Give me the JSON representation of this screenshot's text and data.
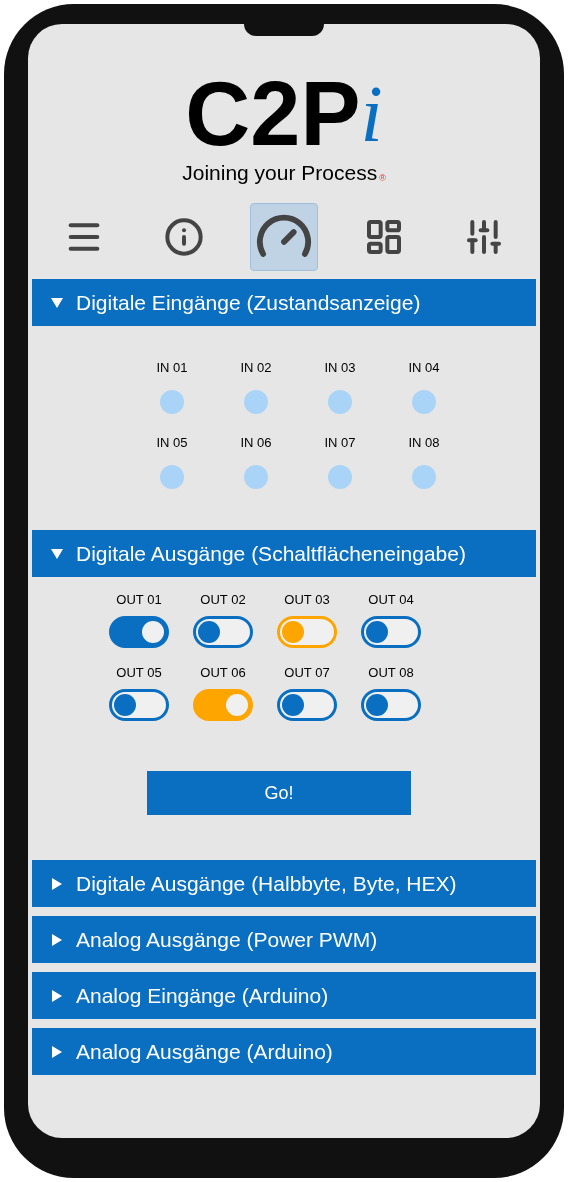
{
  "logo": {
    "main": "C2P",
    "accent": "i",
    "tagline": "Joining your Process",
    "mark": "®"
  },
  "nav": [
    {
      "kind": "menu",
      "selected": false
    },
    {
      "kind": "info",
      "selected": false
    },
    {
      "kind": "gauge",
      "selected": true
    },
    {
      "kind": "dashboard",
      "selected": false
    },
    {
      "kind": "sliders",
      "selected": false
    }
  ],
  "sections": [
    {
      "title": "Digitale Eingänge (Zustandsanzeige)",
      "expanded": true,
      "kind": "inputs",
      "items": [
        {
          "label": "IN 01",
          "on": false
        },
        {
          "label": "IN 02",
          "on": false
        },
        {
          "label": "IN 03",
          "on": false
        },
        {
          "label": "IN 04",
          "on": false
        },
        {
          "label": "IN 05",
          "on": false
        },
        {
          "label": "IN 06",
          "on": false
        },
        {
          "label": "IN 07",
          "on": false
        },
        {
          "label": "IN 08",
          "on": false
        }
      ]
    },
    {
      "title": "Digitale Ausgänge (Schaltflächeneingabe)",
      "expanded": true,
      "kind": "outputs",
      "button": "Go!",
      "items": [
        {
          "label": "OUT 01",
          "on": true,
          "color": "#0b6fc1"
        },
        {
          "label": "OUT 02",
          "on": false,
          "color": "#0b6fc1"
        },
        {
          "label": "OUT 03",
          "on": false,
          "color": "#ffa500"
        },
        {
          "label": "OUT 04",
          "on": false,
          "color": "#0b6fc1"
        },
        {
          "label": "OUT 05",
          "on": false,
          "color": "#0b6fc1"
        },
        {
          "label": "OUT 06",
          "on": true,
          "color": "#ffa500"
        },
        {
          "label": "OUT 07",
          "on": false,
          "color": "#0b6fc1"
        },
        {
          "label": "OUT 08",
          "on": false,
          "color": "#0b6fc1"
        }
      ]
    },
    {
      "title": "Digitale Ausgänge (Halbbyte, Byte, HEX)",
      "expanded": false
    },
    {
      "title": "Analog Ausgänge (Power PWM)",
      "expanded": false
    },
    {
      "title": "Analog Eingänge (Arduino)",
      "expanded": false
    },
    {
      "title": "Analog Ausgänge (Arduino)",
      "expanded": false
    }
  ]
}
